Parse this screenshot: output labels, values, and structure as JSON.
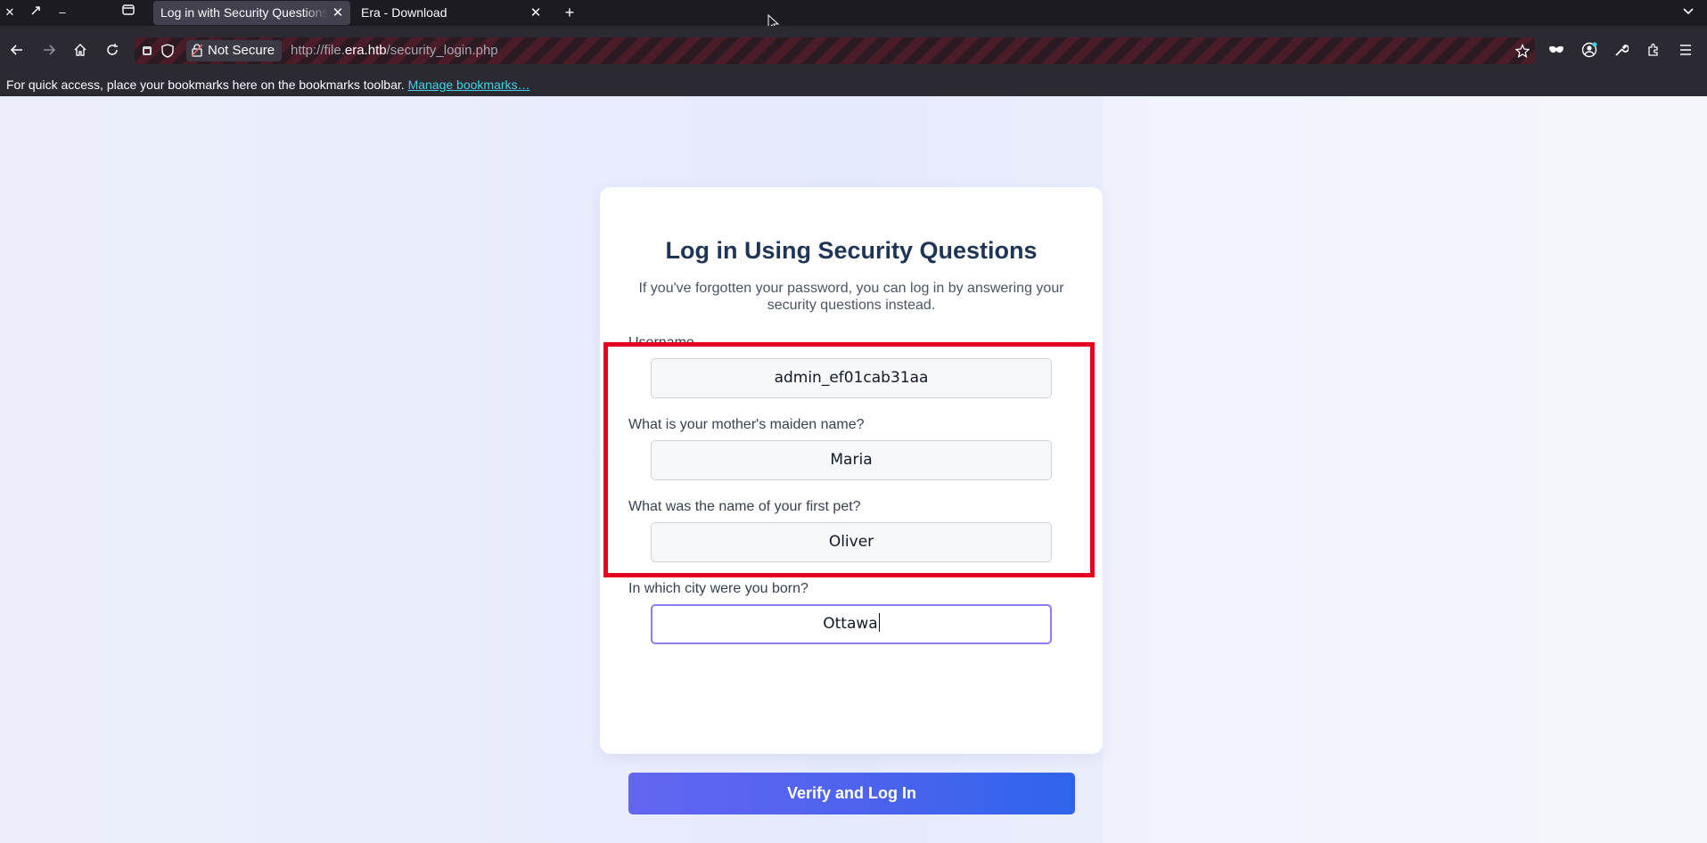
{
  "browser": {
    "tabs": [
      {
        "title": "Log in with Security Questions",
        "active": true
      },
      {
        "title": "Era - Download",
        "active": false
      }
    ],
    "url": {
      "security_label": "Not Secure",
      "prefix": "http://file.",
      "host": "era.htb",
      "path": "/security_login.php"
    },
    "bookmarks_bar": {
      "message": "For quick access, place your bookmarks here on the bookmarks toolbar. ",
      "link": "Manage bookmarks…"
    }
  },
  "page": {
    "title": "Log in Using Security Questions",
    "subtitle": "If you've forgotten your password, you can log in by answering your security questions instead.",
    "fields": {
      "username": {
        "label": "Username",
        "value": "admin_ef01cab31aa"
      },
      "q1": {
        "label": "What is your mother's maiden name?",
        "value": "Maria"
      },
      "q2": {
        "label": "What was the name of your first pet?",
        "value": "Oliver"
      },
      "q3": {
        "label": "In which city were you born?",
        "value": "Ottawa"
      }
    },
    "submit_label": "Verify and Log In"
  },
  "colors": {
    "accent_start": "#6366f1",
    "accent_end": "#2f64ea",
    "highlight": "#e5001f",
    "title": "#1f3556"
  }
}
